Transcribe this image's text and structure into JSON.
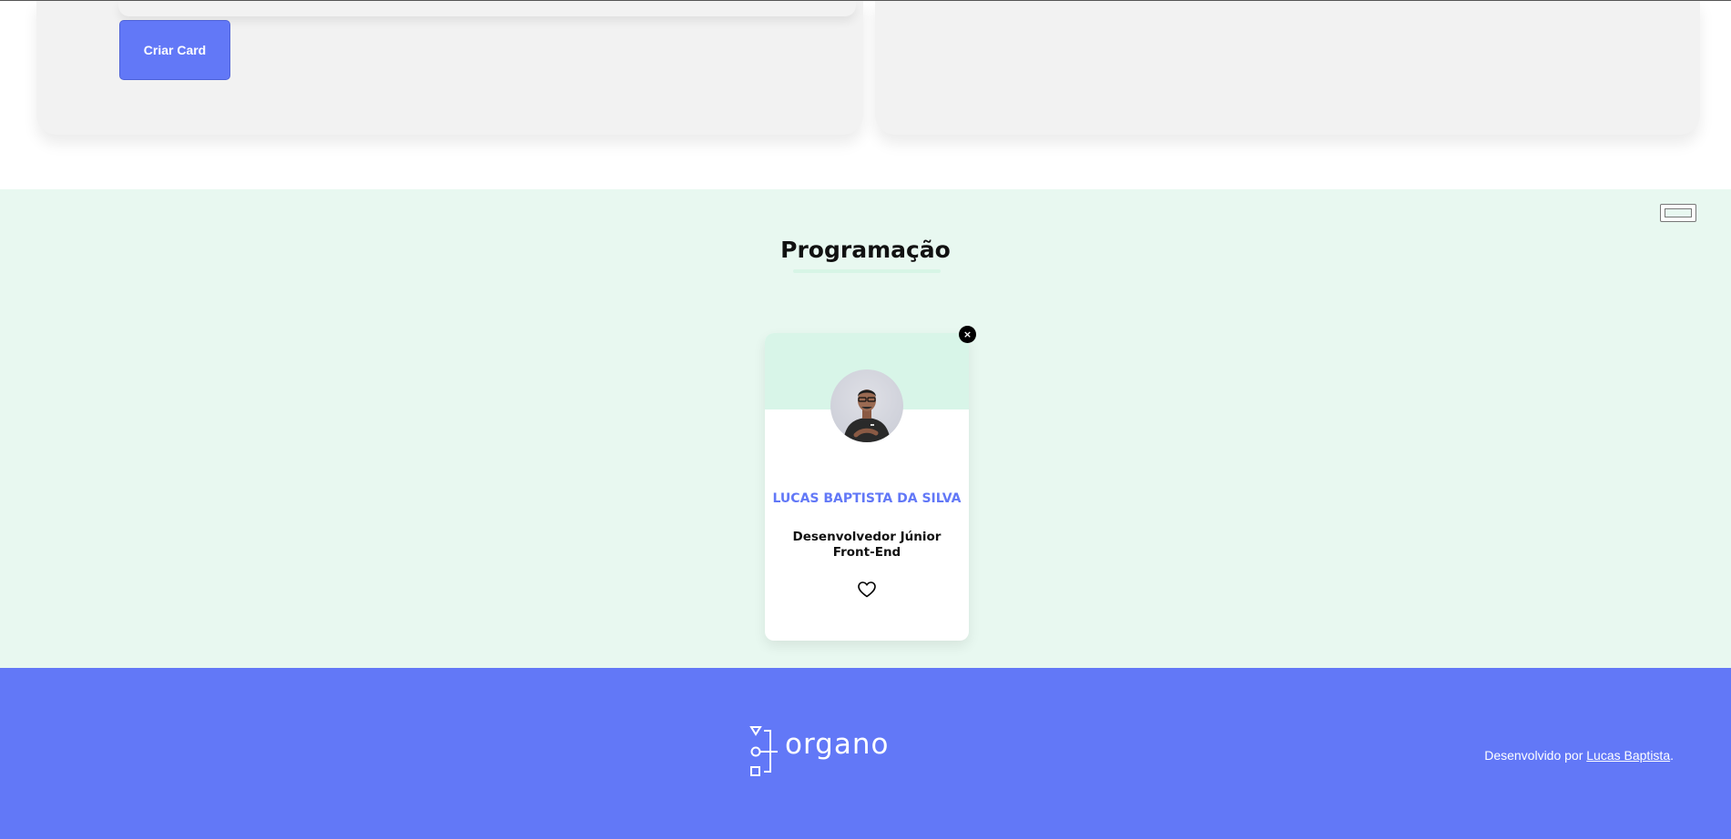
{
  "form": {
    "create_button_label": "Criar Card"
  },
  "team": {
    "title": "Programação",
    "color": "#e8f8f0",
    "accent": "#d8f5e8",
    "members": [
      {
        "name": "LUCAS BAPTISTA DA SILVA",
        "role": "Desenvolvedor Júnior Front-End",
        "close_label": "×",
        "favorite_icon": "heart-outline-icon"
      }
    ]
  },
  "footer": {
    "logo_text": "organo",
    "credit_prefix": "Desenvolvido por ",
    "credit_link": "Lucas Baptista",
    "credit_suffix": "."
  },
  "colors": {
    "primary": "#6278f7",
    "page_bg": "#ffffff",
    "panel_bg": "#f2f2f2"
  }
}
